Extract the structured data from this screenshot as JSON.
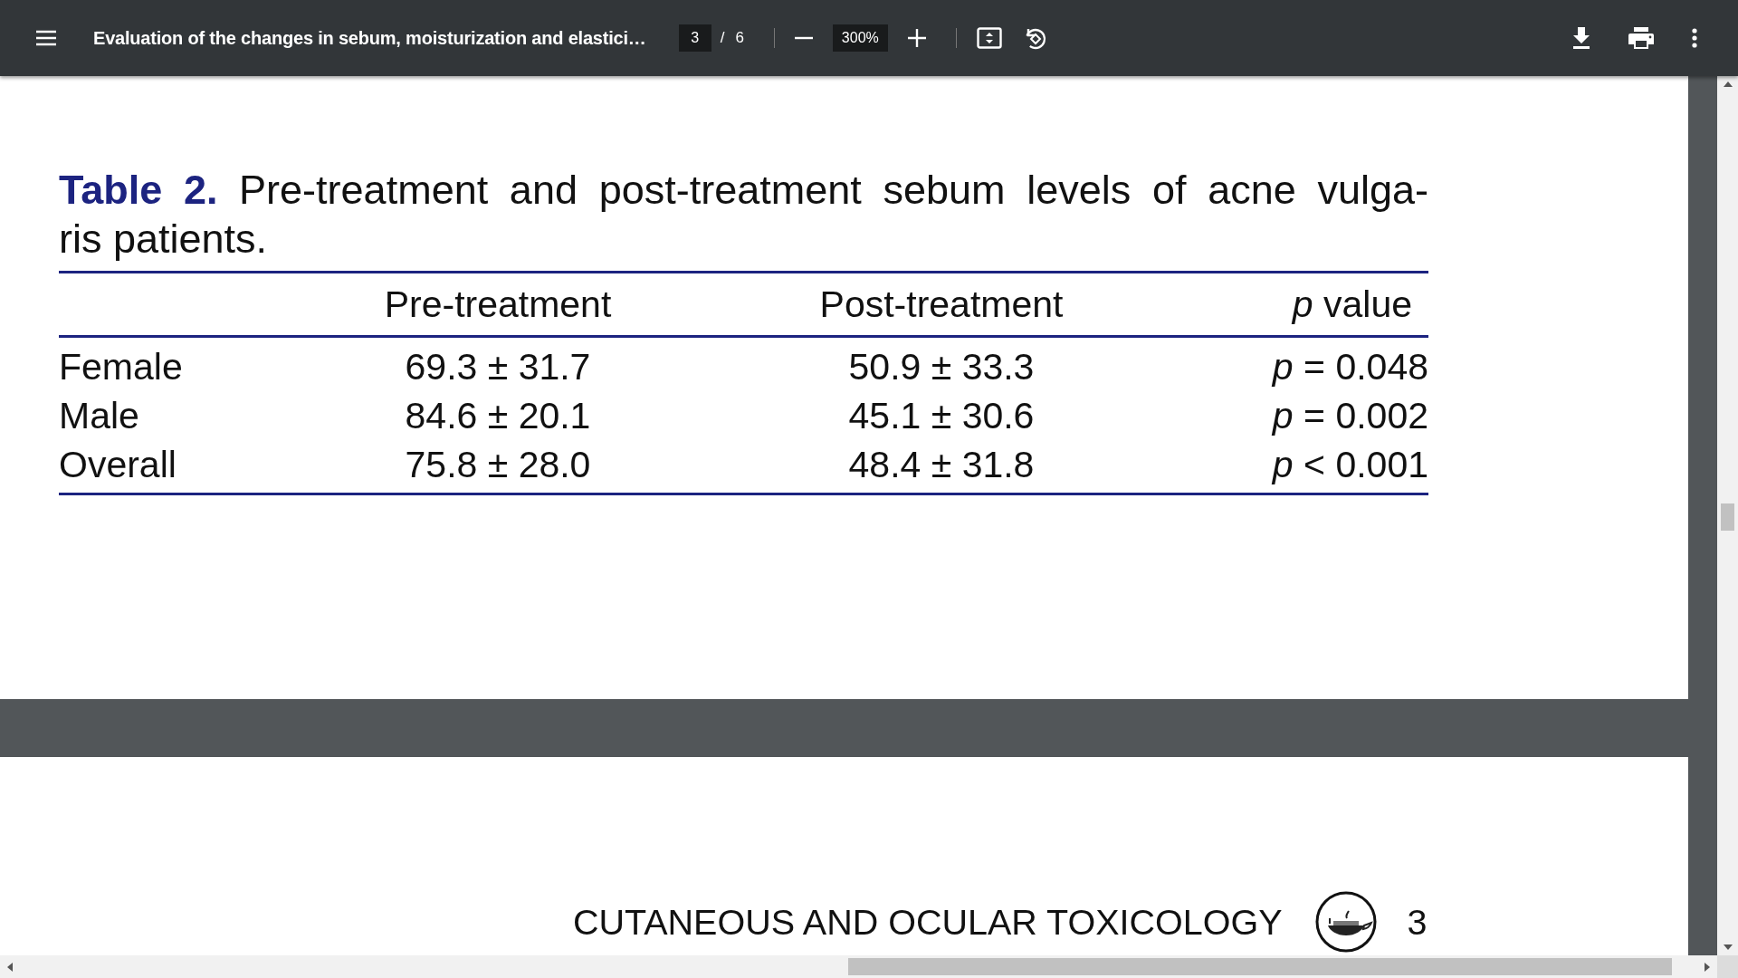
{
  "toolbar": {
    "title": "Evaluation of the changes in sebum, moisturization and elastici…",
    "page_input": "3",
    "page_separator": "/",
    "page_count": "6",
    "zoom": "300%"
  },
  "page": {
    "caption_lines": [
      "**Table 2.** Pre-treatment and post-treatment sebum levels of acne vulga-",
      "ris patients."
    ],
    "table": {
      "header": [
        "Pre-treatment",
        "Post-treatment",
        "*p* value"
      ],
      "rows": [
        {
          "label": "Female",
          "cells": [
            "69.3 ± 31.7",
            "50.9 ± 33.3",
            "*p* = 0.048"
          ]
        },
        {
          "label": "Male",
          "cells": [
            "84.6 ± 20.1",
            "45.1 ± 30.6",
            "*p* = 0.002"
          ]
        },
        {
          "label": "Overall",
          "cells": [
            "75.8 ± 28.0",
            "48.4 ± 31.8",
            "*p* < 0.001"
          ]
        }
      ]
    }
  },
  "next_page": {
    "journal": "CUTANEOUS AND OCULAR TOXICOLOGY",
    "page_number": "3"
  }
}
